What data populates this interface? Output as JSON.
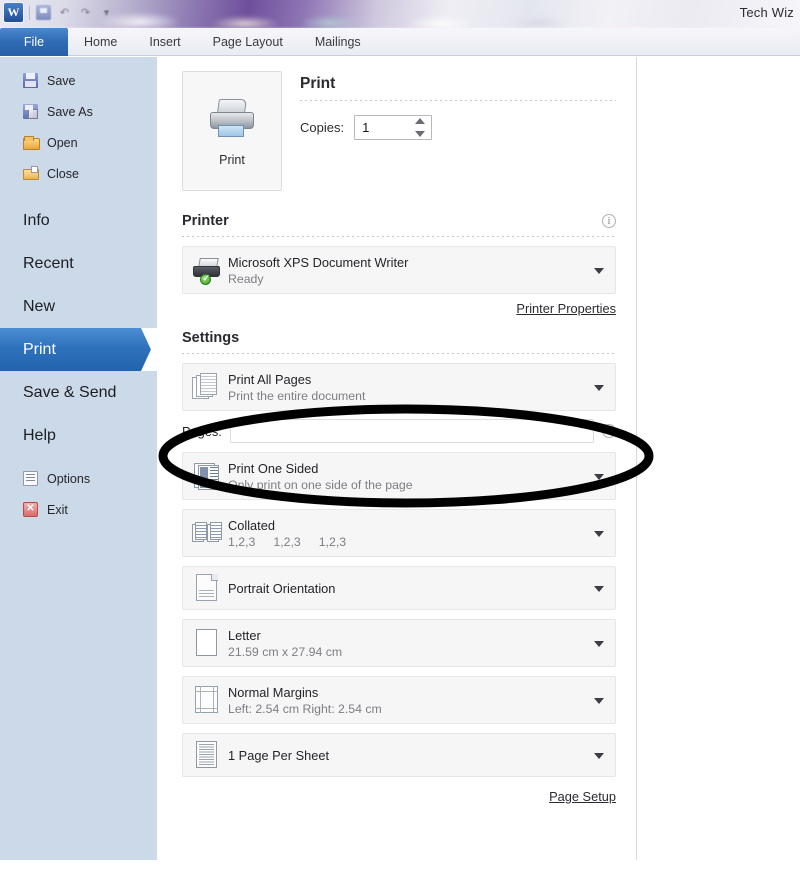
{
  "window": {
    "title": "Tech Wiz",
    "app_logo": "W",
    "quick_access": [
      "save-icon",
      "undo-icon",
      "redo-icon",
      "customize-icon"
    ]
  },
  "ribbon": {
    "tabs": [
      {
        "label": "File",
        "active": true
      },
      {
        "label": "Home",
        "active": false
      },
      {
        "label": "Insert",
        "active": false
      },
      {
        "label": "Page Layout",
        "active": false
      },
      {
        "label": "Mailings",
        "active": false
      }
    ]
  },
  "sidebar": {
    "commands": [
      {
        "label": "Save",
        "icon": "save-icon"
      },
      {
        "label": "Save As",
        "icon": "save-as-icon"
      },
      {
        "label": "Open",
        "icon": "open-folder-icon"
      },
      {
        "label": "Close",
        "icon": "close-folder-icon"
      }
    ],
    "pages": [
      {
        "label": "Info",
        "active": false
      },
      {
        "label": "Recent",
        "active": false
      },
      {
        "label": "New",
        "active": false
      },
      {
        "label": "Print",
        "active": true
      },
      {
        "label": "Save & Send",
        "active": false
      },
      {
        "label": "Help",
        "active": false
      }
    ],
    "footer": [
      {
        "label": "Options",
        "icon": "options-icon"
      },
      {
        "label": "Exit",
        "icon": "exit-icon"
      }
    ],
    "accent_color": "#2e72bd",
    "background_color": "#ccd9e8"
  },
  "print_pane": {
    "print_button": {
      "label": "Print",
      "icon": "printer-icon"
    },
    "heading": "Print",
    "copies": {
      "label": "Copies:",
      "value": "1"
    },
    "printer_section": {
      "title": "Printer",
      "info_icon": "info-icon",
      "selected": {
        "name": "Microsoft XPS Document Writer",
        "status": "Ready",
        "icon": "printer-status-icon"
      },
      "properties_link": "Printer Properties"
    },
    "settings_section": {
      "title": "Settings",
      "items": [
        {
          "title": "Print All Pages",
          "subtitle": "Print the entire document",
          "icon": "pages-stack-icon"
        },
        {
          "title": "Print One Sided",
          "subtitle": "Only print on one side of the page",
          "icon": "one-sided-icon"
        },
        {
          "title": "Collated",
          "subtitle": "1,2,3   1,2,3   1,2,3",
          "icon": "collate-icon"
        },
        {
          "title": "Portrait Orientation",
          "subtitle": "",
          "icon": "portrait-icon"
        },
        {
          "title": "Letter",
          "subtitle": "21.59 cm x 27.94 cm",
          "icon": "letter-icon"
        },
        {
          "title": "Normal Margins",
          "subtitle": "Left:  2.54 cm    Right:  2.54 cm",
          "icon": "margins-icon"
        },
        {
          "title": "1 Page Per Sheet",
          "subtitle": "",
          "icon": "pages-per-sheet-icon"
        }
      ],
      "pages_field": {
        "label": "Pages:",
        "value": "",
        "info_icon": "info-icon"
      },
      "page_setup_link": "Page Setup"
    },
    "collated_numbers": [
      "1,2,3",
      "1,2,3",
      "1,2,3"
    ]
  },
  "annotation": {
    "shape": "ellipse",
    "color": "#000000",
    "target": "Print One Sided"
  }
}
